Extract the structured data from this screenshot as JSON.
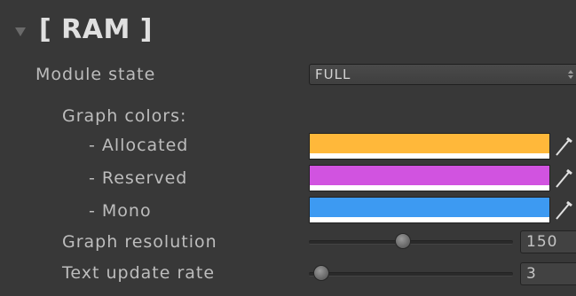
{
  "module": {
    "title": "[ RAM ]",
    "state_label": "Module state",
    "state_value": "FULL"
  },
  "graph_colors": {
    "label": "Graph colors:",
    "items": [
      {
        "label": "- Allocated",
        "color": "#ffb83a"
      },
      {
        "label": "- Reserved",
        "color": "#d153e0"
      },
      {
        "label": "- Mono",
        "color": "#3d9af2"
      }
    ]
  },
  "graph_resolution": {
    "label": "Graph resolution",
    "value": "150",
    "slider_fraction": 0.46
  },
  "text_update_rate": {
    "label": "Text update rate",
    "value": "3",
    "slider_fraction": 0.06
  },
  "icons": {
    "foldout": "foldout-arrow-icon",
    "dropdown": "dropdown-arrows-icon",
    "picker": "eyedropper-icon"
  }
}
